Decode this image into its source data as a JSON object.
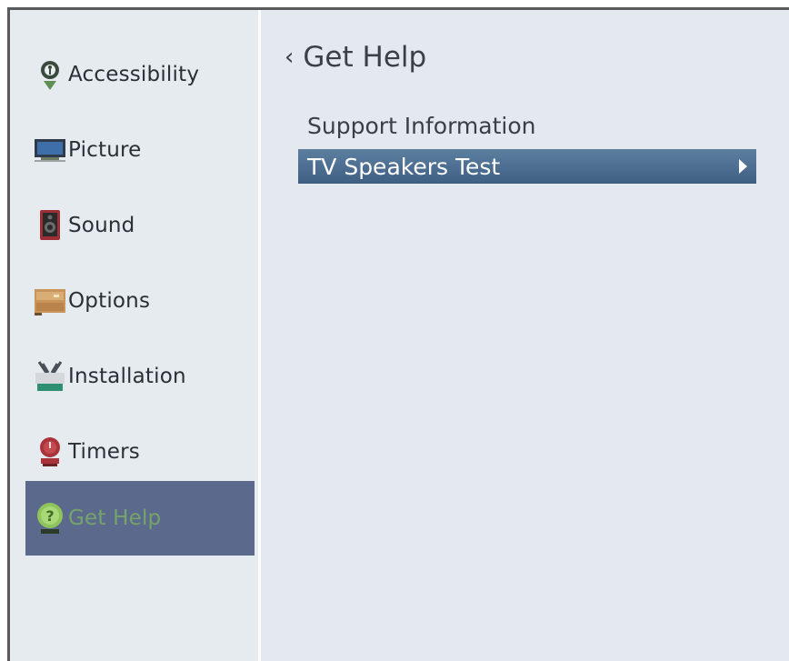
{
  "sidebar": {
    "items": [
      {
        "label": "Accessibility",
        "icon": "accessibility-icon"
      },
      {
        "label": "Picture",
        "icon": "picture-icon"
      },
      {
        "label": "Sound",
        "icon": "sound-icon"
      },
      {
        "label": "Options",
        "icon": "options-icon"
      },
      {
        "label": "Installation",
        "icon": "installation-icon"
      },
      {
        "label": "Timers",
        "icon": "timers-icon"
      },
      {
        "label": "Get Help",
        "icon": "help-icon",
        "selected": true
      }
    ]
  },
  "main": {
    "back_label": "Get Help",
    "items": [
      {
        "label": "Support Information"
      },
      {
        "label": "TV Speakers Test",
        "highlighted": true
      }
    ]
  },
  "colors": {
    "sidebar_selected": "#5b6a8c",
    "menu_highlight": "#4a6b8e",
    "background": "#e3e9ef"
  }
}
